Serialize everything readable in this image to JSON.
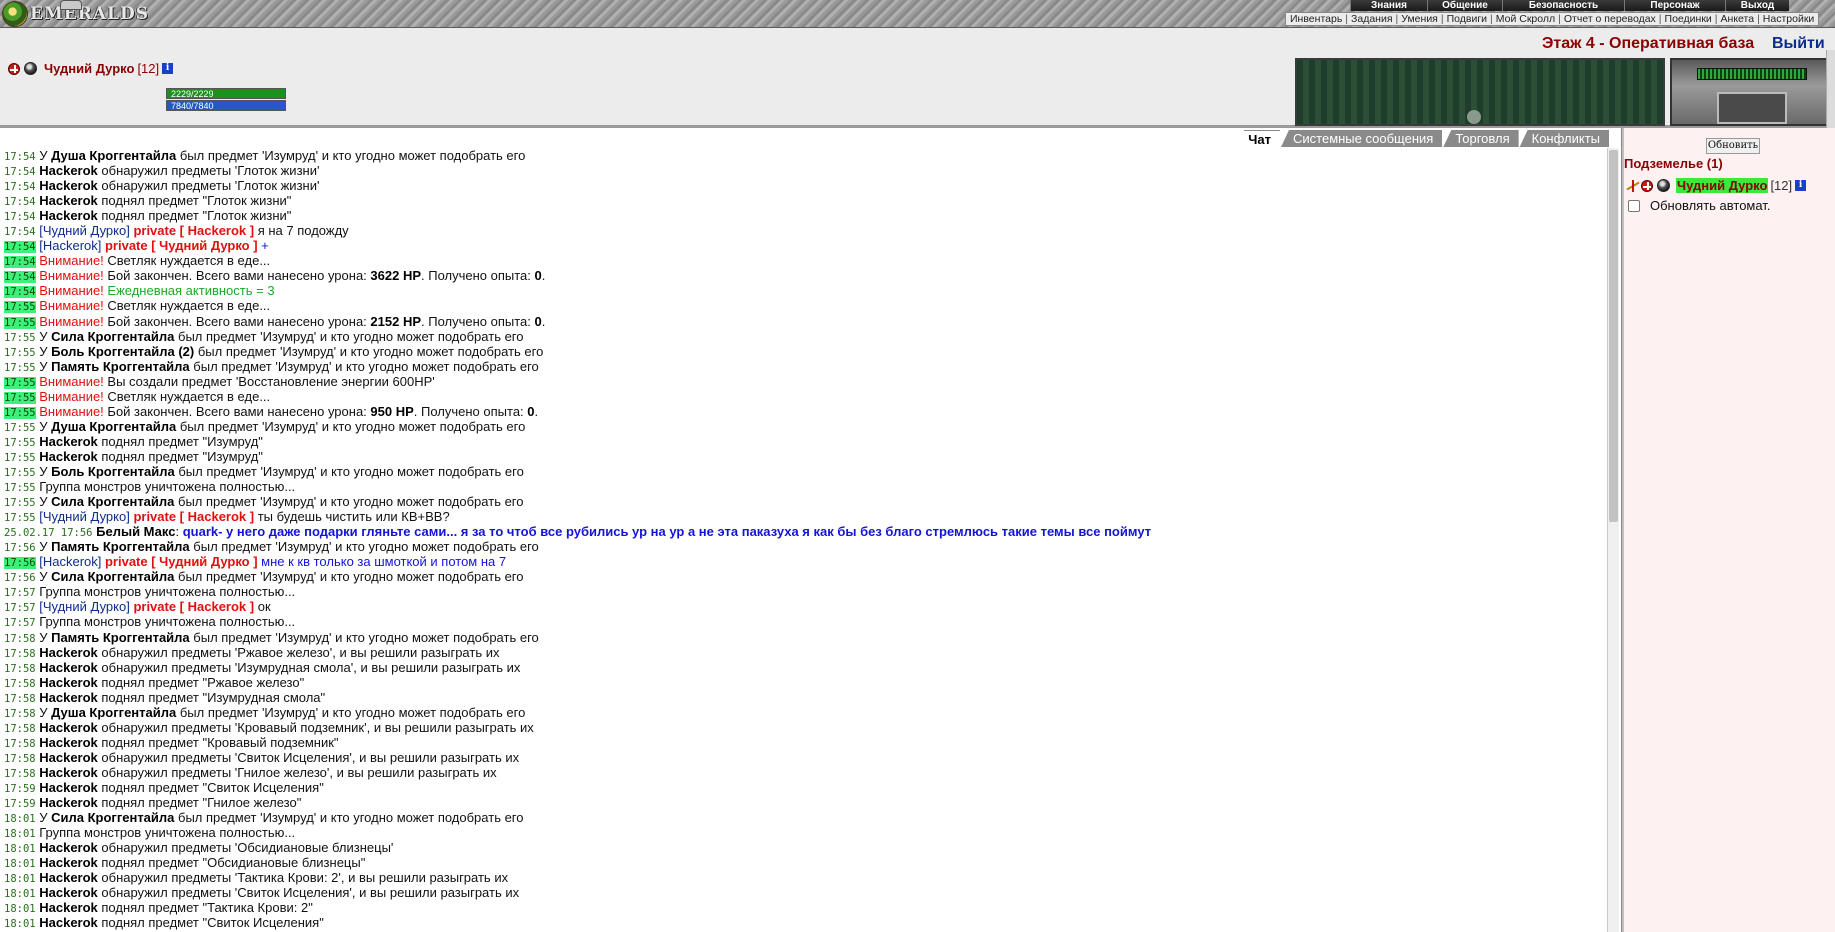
{
  "logo": {
    "text": "EMERALDS"
  },
  "main_menu": [
    "Знания",
    "Общение",
    "Безопасность",
    "Персонаж",
    "Выход"
  ],
  "sub_menu": [
    "Инвентарь",
    "Задания",
    "Умения",
    "Подвиги",
    "Мой Скролл",
    "Отчет о переводах",
    "Поединки",
    "Анкета",
    "Настройки"
  ],
  "character": {
    "name": "Чудний Дурко",
    "level": "[12]",
    "hp": "2229/2229",
    "mp": "7840/7840",
    "hp_color": "#1d8f1d",
    "mp_color": "#2856c8"
  },
  "location": {
    "title": "Этаж 4 - Оперативная база",
    "exit": "Выйти"
  },
  "tabs": [
    "Чат",
    "Системные сообщения",
    "Торговля",
    "Конфликты"
  ],
  "chat": [
    {
      "t": "17:54",
      "h": false,
      "p": [
        [
          "",
          "У "
        ],
        [
          "nm",
          "Душа Кроггентайла"
        ],
        [
          "",
          " был предмет 'Изумруд' и кто угодно может подобрать его"
        ]
      ]
    },
    {
      "t": "17:54",
      "h": false,
      "p": [
        [
          "nm",
          "Hackerok"
        ],
        [
          "",
          " обнаружил предметы 'Глоток жизни'"
        ]
      ]
    },
    {
      "t": "17:54",
      "h": false,
      "p": [
        [
          "nm",
          "Hackerok"
        ],
        [
          "",
          " обнаружил предметы 'Глоток жизни'"
        ]
      ]
    },
    {
      "t": "17:54",
      "h": false,
      "p": [
        [
          "nm",
          "Hackerok"
        ],
        [
          "",
          " поднял предмет \"Глоток жизни\""
        ]
      ]
    },
    {
      "t": "17:54",
      "h": false,
      "p": [
        [
          "nm",
          "Hackerok"
        ],
        [
          "",
          " поднял предмет \"Глоток жизни\""
        ]
      ]
    },
    {
      "t": "17:54",
      "h": false,
      "p": [
        [
          "me",
          "[Чудний Дурко]"
        ],
        [
          "priv",
          " private [ Hackerok ]"
        ],
        [
          "",
          " я на 7 подожду"
        ]
      ]
    },
    {
      "t": "17:54",
      "h": true,
      "p": [
        [
          "me",
          "[Hackerok]"
        ],
        [
          "priv",
          " private [ Чудний Дурко ]"
        ],
        [
          "blue",
          " +"
        ]
      ]
    },
    {
      "t": "17:54",
      "h": true,
      "p": [
        [
          "warn",
          "Внимание!"
        ],
        [
          "",
          " Светляк нуждается в еде..."
        ]
      ]
    },
    {
      "t": "17:54",
      "h": true,
      "p": [
        [
          "warn",
          "Внимание!"
        ],
        [
          "",
          " Бой закончен. Всего вами нанесено урона: "
        ],
        [
          "v",
          "3622 HP"
        ],
        [
          "",
          ". Получено опыта: "
        ],
        [
          "v",
          "0"
        ],
        [
          "",
          "."
        ]
      ]
    },
    {
      "t": "17:54",
      "h": true,
      "p": [
        [
          "warn",
          "Внимание!"
        ],
        [
          "ok",
          " Ежедневная активность = 3"
        ]
      ]
    },
    {
      "t": "17:55",
      "h": true,
      "p": [
        [
          "warn",
          "Внимание!"
        ],
        [
          "",
          " Светляк нуждается в еде..."
        ]
      ]
    },
    {
      "t": "17:55",
      "h": true,
      "p": [
        [
          "warn",
          "Внимание!"
        ],
        [
          "",
          " Бой закончен. Всего вами нанесено урона: "
        ],
        [
          "v",
          "2152 HP"
        ],
        [
          "",
          ". Получено опыта: "
        ],
        [
          "v",
          "0"
        ],
        [
          "",
          "."
        ]
      ]
    },
    {
      "t": "17:55",
      "h": false,
      "p": [
        [
          "",
          "У "
        ],
        [
          "nm",
          "Сила Кроггентайла"
        ],
        [
          "",
          " был предмет 'Изумруд' и кто угодно может подобрать его"
        ]
      ]
    },
    {
      "t": "17:55",
      "h": false,
      "p": [
        [
          "",
          "У "
        ],
        [
          "nm",
          "Боль Кроггентайла (2)"
        ],
        [
          "",
          " был предмет 'Изумруд' и кто угодно может подобрать его"
        ]
      ]
    },
    {
      "t": "17:55",
      "h": false,
      "p": [
        [
          "",
          "У "
        ],
        [
          "nm",
          "Память Кроггентайла"
        ],
        [
          "",
          " был предмет 'Изумруд' и кто угодно может подобрать его"
        ]
      ]
    },
    {
      "t": "17:55",
      "h": true,
      "p": [
        [
          "warn",
          "Внимание!"
        ],
        [
          "",
          " Вы создали предмет 'Восстановление энергии 600HP'"
        ]
      ]
    },
    {
      "t": "17:55",
      "h": true,
      "p": [
        [
          "warn",
          "Внимание!"
        ],
        [
          "",
          " Светляк нуждается в еде..."
        ]
      ]
    },
    {
      "t": "17:55",
      "h": true,
      "p": [
        [
          "warn",
          "Внимание!"
        ],
        [
          "",
          " Бой закончен. Всего вами нанесено урона: "
        ],
        [
          "v",
          "950 HP"
        ],
        [
          "",
          ". Получено опыта: "
        ],
        [
          "v",
          "0"
        ],
        [
          "",
          "."
        ]
      ]
    },
    {
      "t": "17:55",
      "h": false,
      "p": [
        [
          "",
          "У "
        ],
        [
          "nm",
          "Душа Кроггентайла"
        ],
        [
          "",
          " был предмет 'Изумруд' и кто угодно может подобрать его"
        ]
      ]
    },
    {
      "t": "17:55",
      "h": false,
      "p": [
        [
          "nm",
          "Hackerok"
        ],
        [
          "",
          " поднял предмет \"Изумруд\""
        ]
      ]
    },
    {
      "t": "17:55",
      "h": false,
      "p": [
        [
          "nm",
          "Hackerok"
        ],
        [
          "",
          " поднял предмет \"Изумруд\""
        ]
      ]
    },
    {
      "t": "17:55",
      "h": false,
      "p": [
        [
          "",
          "У "
        ],
        [
          "nm",
          "Боль Кроггентайла"
        ],
        [
          "",
          " был предмет 'Изумруд' и кто угодно может подобрать его"
        ]
      ]
    },
    {
      "t": "17:55",
      "h": false,
      "p": [
        [
          "",
          "Группа монстров уничтожена полностью..."
        ]
      ]
    },
    {
      "t": "17:55",
      "h": false,
      "p": [
        [
          "",
          "У "
        ],
        [
          "nm",
          "Сила Кроггентайла"
        ],
        [
          "",
          " был предмет 'Изумруд' и кто угодно может подобрать его"
        ]
      ]
    },
    {
      "t": "17:55",
      "h": false,
      "p": [
        [
          "me",
          "[Чудний Дурко]"
        ],
        [
          "priv",
          " private [ Hackerok ]"
        ],
        [
          "",
          " ты будешь чистить или КВ+ВВ?"
        ]
      ]
    },
    {
      "t": "25.02.17 17:56",
      "h": false,
      "p": [
        [
          "nm",
          "Белый Макс"
        ],
        [
          "",
          ": "
        ],
        [
          "blueb",
          "quark- у него даже подарки гляньте сами... я за то чтоб все рубились ур на ур а не эта паказуха я как бы без благо стремлюсь такие темы все поймут"
        ]
      ]
    },
    {
      "t": "17:56",
      "h": false,
      "p": [
        [
          "",
          "У "
        ],
        [
          "nm",
          "Память Кроггентайла"
        ],
        [
          "",
          " был предмет 'Изумруд' и кто угодно может подобрать его"
        ]
      ]
    },
    {
      "t": "17:56",
      "h": true,
      "p": [
        [
          "me",
          "[Hackerok]"
        ],
        [
          "priv",
          " private [ Чудний Дурко ]"
        ],
        [
          "blue",
          " мне к кв только за шмоткой и потом на 7"
        ]
      ]
    },
    {
      "t": "17:56",
      "h": false,
      "p": [
        [
          "",
          "У "
        ],
        [
          "nm",
          "Сила Кроггентайла"
        ],
        [
          "",
          " был предмет 'Изумруд' и кто угодно может подобрать его"
        ]
      ]
    },
    {
      "t": "17:57",
      "h": false,
      "p": [
        [
          "",
          "Группа монстров уничтожена полностью..."
        ]
      ]
    },
    {
      "t": "17:57",
      "h": false,
      "p": [
        [
          "me",
          "[Чудний Дурко]"
        ],
        [
          "priv",
          " private [ Hackerok ]"
        ],
        [
          "",
          " ок"
        ]
      ]
    },
    {
      "t": "17:57",
      "h": false,
      "p": [
        [
          "",
          "Группа монстров уничтожена полностью..."
        ]
      ]
    },
    {
      "t": "17:58",
      "h": false,
      "p": [
        [
          "",
          "У "
        ],
        [
          "nm",
          "Память Кроггентайла"
        ],
        [
          "",
          " был предмет 'Изумруд' и кто угодно может подобрать его"
        ]
      ]
    },
    {
      "t": "17:58",
      "h": false,
      "p": [
        [
          "nm",
          "Hackerok"
        ],
        [
          "",
          " обнаружил предметы 'Ржавое железо', и вы решили разыграть их"
        ]
      ]
    },
    {
      "t": "17:58",
      "h": false,
      "p": [
        [
          "nm",
          "Hackerok"
        ],
        [
          "",
          " обнаружил предметы 'Изумрудная смола', и вы решили разыграть их"
        ]
      ]
    },
    {
      "t": "17:58",
      "h": false,
      "p": [
        [
          "nm",
          "Hackerok"
        ],
        [
          "",
          " поднял предмет \"Ржавое железо\""
        ]
      ]
    },
    {
      "t": "17:58",
      "h": false,
      "p": [
        [
          "nm",
          "Hackerok"
        ],
        [
          "",
          " поднял предмет \"Изумрудная смола\""
        ]
      ]
    },
    {
      "t": "17:58",
      "h": false,
      "p": [
        [
          "",
          "У "
        ],
        [
          "nm",
          "Душа Кроггентайла"
        ],
        [
          "",
          " был предмет 'Изумруд' и кто угодно может подобрать его"
        ]
      ]
    },
    {
      "t": "17:58",
      "h": false,
      "p": [
        [
          "nm",
          "Hackerok"
        ],
        [
          "",
          " обнаружил предметы 'Кровавый подземник', и вы решили разыграть их"
        ]
      ]
    },
    {
      "t": "17:58",
      "h": false,
      "p": [
        [
          "nm",
          "Hackerok"
        ],
        [
          "",
          " поднял предмет \"Кровавый подземник\""
        ]
      ]
    },
    {
      "t": "17:58",
      "h": false,
      "p": [
        [
          "nm",
          "Hackerok"
        ],
        [
          "",
          " обнаружил предметы 'Свиток Исцеления', и вы решили разыграть их"
        ]
      ]
    },
    {
      "t": "17:58",
      "h": false,
      "p": [
        [
          "nm",
          "Hackerok"
        ],
        [
          "",
          " обнаружил предметы 'Гнилое железо', и вы решили разыграть их"
        ]
      ]
    },
    {
      "t": "17:59",
      "h": false,
      "p": [
        [
          "nm",
          "Hackerok"
        ],
        [
          "",
          " поднял предмет \"Свиток Исцеления\""
        ]
      ]
    },
    {
      "t": "17:59",
      "h": false,
      "p": [
        [
          "nm",
          "Hackerok"
        ],
        [
          "",
          " поднял предмет \"Гнилое железо\""
        ]
      ]
    },
    {
      "t": "18:01",
      "h": false,
      "p": [
        [
          "",
          "У "
        ],
        [
          "nm",
          "Сила Кроггентайла"
        ],
        [
          "",
          " был предмет 'Изумруд' и кто угодно может подобрать его"
        ]
      ]
    },
    {
      "t": "18:01",
      "h": false,
      "p": [
        [
          "",
          "Группа монстров уничтожена полностью..."
        ]
      ]
    },
    {
      "t": "18:01",
      "h": false,
      "p": [
        [
          "nm",
          "Hackerok"
        ],
        [
          "",
          " обнаружил предметы 'Обсидиановые близнецы'"
        ]
      ]
    },
    {
      "t": "18:01",
      "h": false,
      "p": [
        [
          "nm",
          "Hackerok"
        ],
        [
          "",
          " поднял предмет \"Обсидиановые близнецы\""
        ]
      ]
    },
    {
      "t": "18:01",
      "h": false,
      "p": [
        [
          "nm",
          "Hackerok"
        ],
        [
          "",
          " обнаружил предметы 'Тактика Крови: 2', и вы решили разыграть их"
        ]
      ]
    },
    {
      "t": "18:01",
      "h": false,
      "p": [
        [
          "nm",
          "Hackerok"
        ],
        [
          "",
          " обнаружил предметы 'Свиток Исцеления', и вы решили разыграть их"
        ]
      ]
    },
    {
      "t": "18:01",
      "h": false,
      "p": [
        [
          "nm",
          "Hackerok"
        ],
        [
          "",
          " поднял предмет \"Тактика Крови: 2\""
        ]
      ]
    },
    {
      "t": "18:01",
      "h": false,
      "p": [
        [
          "nm",
          "Hackerok"
        ],
        [
          "",
          " поднял предмет \"Свиток Исцеления\""
        ]
      ]
    }
  ],
  "right_panel": {
    "refresh_button": "Обновить",
    "group_title": "Подземелье (1)",
    "member_name": "Чудний Дурко",
    "member_level": "[12]",
    "auto_refresh_label": "Обновлять автомат.",
    "auto_refresh_checked": false
  }
}
